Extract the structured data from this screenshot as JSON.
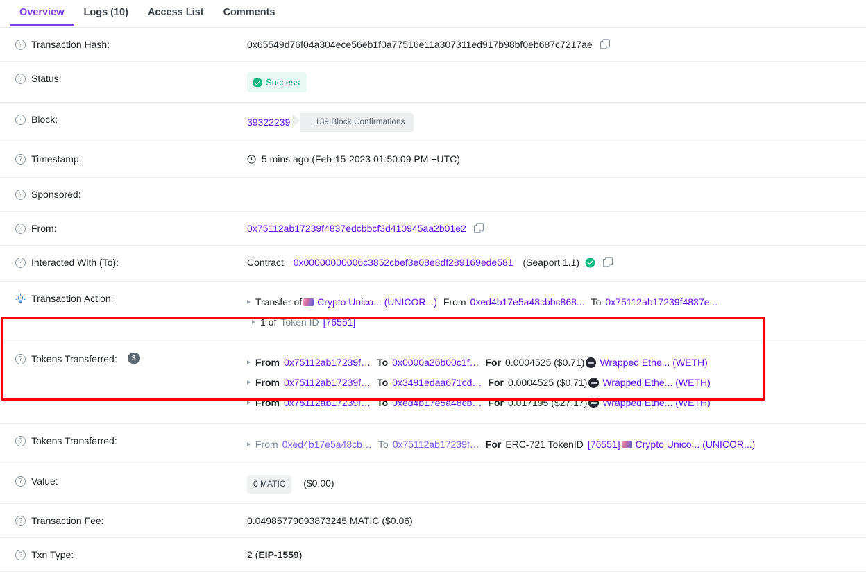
{
  "tabs": [
    {
      "label": "Overview",
      "active": true
    },
    {
      "label": "Logs (10)",
      "active": false
    },
    {
      "label": "Access List",
      "active": false
    },
    {
      "label": "Comments",
      "active": false
    }
  ],
  "colors": {
    "accent_purple": "#7b3fe4",
    "link_purple": "#6610f2",
    "success_green": "#00a97f",
    "success_bg": "#e9f9f3",
    "highlight_red": "#ff0000",
    "badge_gray": "#5a6570",
    "divider": "#eceef0"
  },
  "rows": {
    "transaction_hash": {
      "label": "Transaction Hash:",
      "value": "0x65549d76f04a304ece56eb1f0a77516e11a307311ed917b98bf0eb687c7217ae",
      "copy_icon": "copy-icon"
    },
    "status": {
      "label": "Status:",
      "value": "Success",
      "icon": "check-circle-icon"
    },
    "block": {
      "label": "Block:",
      "number": "39322239",
      "confirmations": "139 Block Confirmations"
    },
    "timestamp": {
      "label": "Timestamp:",
      "icon": "clock-icon",
      "value": "5 mins ago (Feb-15-2023 01:50:09 PM +UTC)"
    },
    "sponsored": {
      "label": "Sponsored:",
      "value": ""
    },
    "from": {
      "label": "From:",
      "address": "0x75112ab17239f4837edcbbcf3d410945aa2b01e2",
      "copy_icon": "copy-icon"
    },
    "interacted_with": {
      "label": "Interacted With (To):",
      "prefix": "Contract",
      "address": "0x00000000006c3852cbef3e08e8df289169ede581",
      "suffix": "(Seaport 1.1)",
      "verified_icon": "verified-check-icon",
      "copy_icon": "copy-icon"
    },
    "transaction_action": {
      "label": "Transaction Action:",
      "icon": "lightbulb-icon",
      "line1": {
        "prefix": "Transfer of",
        "token_icon": "crypto-unicorn-icon",
        "token": "Crypto Unico... (UNICOR...)",
        "from_label": "From",
        "from": "0xed4b17e5a48cbbc868...",
        "to_label": "To",
        "to": "0x75112ab17239f4837e..."
      },
      "line2": {
        "qty": "1 of",
        "token_id_label": "Token ID",
        "token_id": "[76551]"
      }
    },
    "tokens_transferred_erc20": {
      "label": "Tokens Transferred:",
      "count": "3",
      "transfers": [
        {
          "from_label": "From",
          "from": "0x75112ab17239f…",
          "to_label": "To",
          "to": "0x0000a26b00c1f…",
          "for_label": "For",
          "amount": "0.0004525 ($0.71)",
          "token_icon": "weth-token-icon",
          "token": "Wrapped Ethe... (WETH)"
        },
        {
          "from_label": "From",
          "from": "0x75112ab17239f…",
          "to_label": "To",
          "to": "0x3491edaa671cd…",
          "for_label": "For",
          "amount": "0.0004525 ($0.71)",
          "token_icon": "weth-token-icon",
          "token": "Wrapped Ethe... (WETH)"
        },
        {
          "from_label": "From",
          "from": "0x75112ab17239f…",
          "to_label": "To",
          "to": "0xed4b17e5a48cb…",
          "for_label": "For",
          "amount": "0.017195 ($27.17)",
          "token_icon": "weth-token-icon",
          "token": "Wrapped Ethe... (WETH)"
        }
      ]
    },
    "tokens_transferred_erc721": {
      "label": "Tokens Transferred:",
      "transfer": {
        "from_label": "From",
        "from": "0xed4b17e5a48cb…",
        "to_label": "To",
        "to": "0x75112ab17239f…",
        "for_label": "For",
        "standard": "ERC-721 TokenID",
        "token_id": "[76551]",
        "token_icon": "crypto-unicorn-icon",
        "token": "Crypto Unico... (UNICOR...)"
      }
    },
    "value": {
      "label": "Value:",
      "pill": "0 MATIC",
      "usd": "($0.00)"
    },
    "transaction_fee": {
      "label": "Transaction Fee:",
      "value": "0.04985779093873245 MATIC ($0.06)"
    },
    "txn_type": {
      "label": "Txn Type:",
      "prefix": "2 (",
      "name": "EIP-1559",
      "suffix": ")"
    }
  }
}
